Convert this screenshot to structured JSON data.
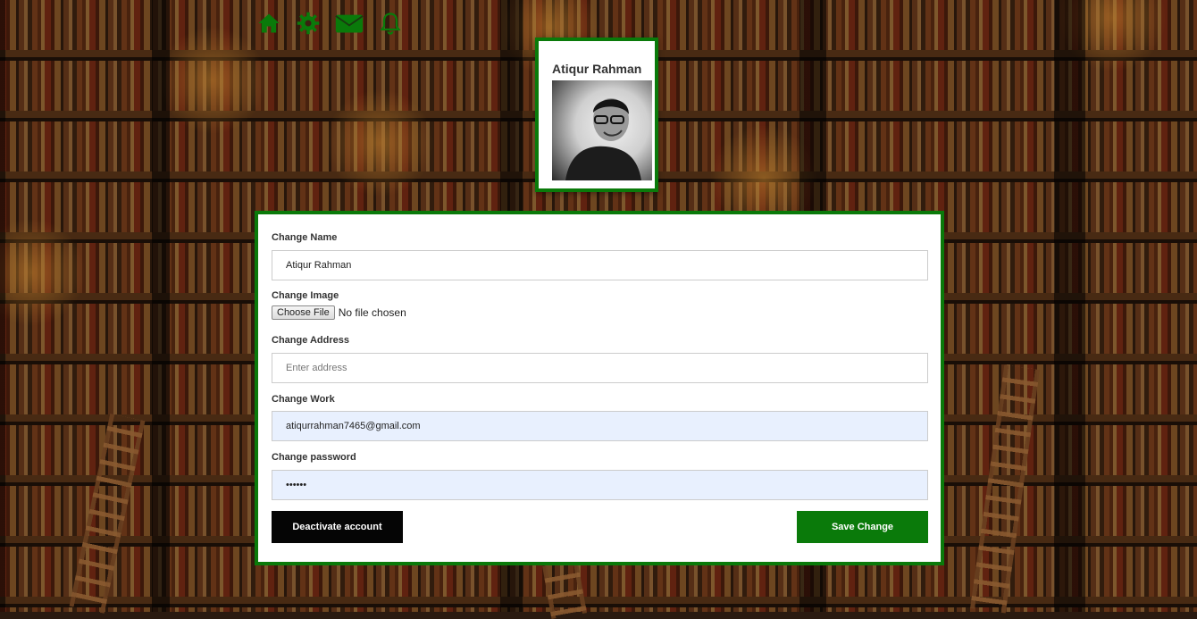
{
  "nav": {
    "icons": [
      "home-icon",
      "gear-icon",
      "envelope-icon",
      "bell-icon"
    ],
    "color": "#0a7a0a"
  },
  "profile": {
    "name": "Atiqur Rahman"
  },
  "form": {
    "name_label": "Change Name",
    "name_value": "Atiqur Rahman",
    "image_label": "Change Image",
    "choose_file_label": "Choose File",
    "file_status": "No file chosen",
    "address_label": "Change Address",
    "address_placeholder": "Enter address",
    "address_value": "",
    "work_label": "Change Work",
    "work_value": "atiqurrahman7465@gmail.com",
    "password_label": "Change password",
    "password_value": "••••••",
    "deactivate_label": "Deactivate account",
    "save_label": "Save Change"
  },
  "colors": {
    "accent": "#0a7a0a",
    "dark_button": "#050505",
    "autofill_bg": "#e8f0fe"
  }
}
